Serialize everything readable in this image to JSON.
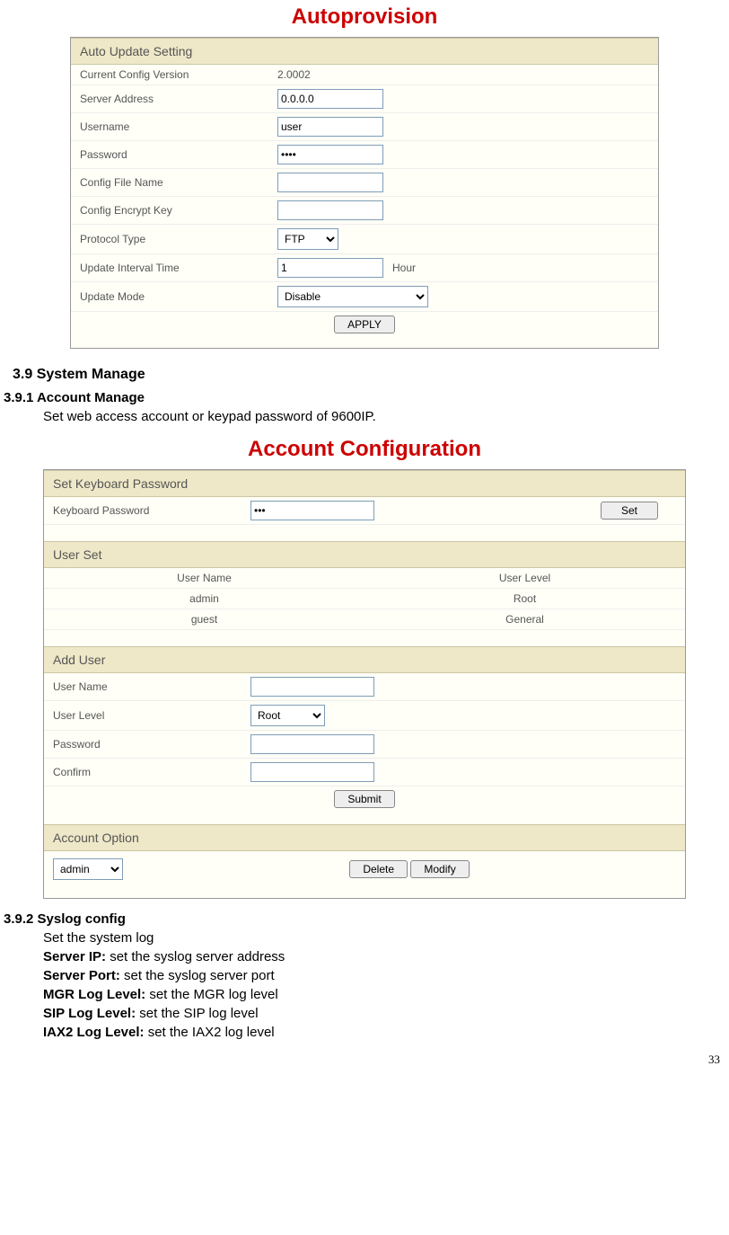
{
  "autoprovision": {
    "title": "Autoprovision",
    "section_header": "Auto Update Setting",
    "labels": {
      "current_config_version": "Current Config Version",
      "server_address": "Server Address",
      "username": "Username",
      "password": "Password",
      "config_file_name": "Config File Name",
      "config_encrypt_key": "Config Encrypt Key",
      "protocol_type": "Protocol Type",
      "update_interval_time": "Update Interval Time",
      "update_mode": "Update Mode",
      "hour": "Hour"
    },
    "values": {
      "current_config_version": "2.0002",
      "server_address": "0.0.0.0",
      "username": "user",
      "password": "••••",
      "config_file_name": "",
      "config_encrypt_key": "",
      "protocol_type": "FTP",
      "update_interval_time": "1",
      "update_mode": "Disable"
    },
    "apply_label": "APPLY"
  },
  "doc": {
    "h39": "3.9 System Manage",
    "h391": "3.9.1 Account Manage",
    "h391_para": "Set web access account or keypad password of 9600IP.",
    "h392": "3.9.2 Syslog config",
    "h392_para": "Set the system log",
    "syslog_lines": [
      {
        "bold": "Server IP:",
        "rest": " set the syslog server address"
      },
      {
        "bold": "Server Port:",
        "rest": " set the syslog server port"
      },
      {
        "bold": "MGR Log Level:",
        "rest": " set the MGR log level"
      },
      {
        "bold": "SIP Log Level:",
        "rest": " set the SIP log level"
      },
      {
        "bold": "IAX2 Log Level:",
        "rest": " set the IAX2 log level"
      }
    ],
    "page_number": "33"
  },
  "account": {
    "title": "Account Configuration",
    "sections": {
      "set_keyboard_password": "Set Keyboard Password",
      "user_set": "User Set",
      "add_user": "Add User",
      "account_option": "Account Option"
    },
    "keyboard_password": {
      "label": "Keyboard Password",
      "value": "•••",
      "set_label": "Set"
    },
    "user_table": {
      "headers": {
        "name": "User Name",
        "level": "User Level"
      },
      "rows": [
        {
          "name": "admin",
          "level": "Root"
        },
        {
          "name": "guest",
          "level": "General"
        }
      ]
    },
    "add_user": {
      "labels": {
        "user_name": "User Name",
        "user_level": "User Level",
        "password": "Password",
        "confirm": "Confirm"
      },
      "values": {
        "user_name": "",
        "user_level": "Root",
        "password": "",
        "confirm": ""
      },
      "submit_label": "Submit"
    },
    "account_option": {
      "select_value": "admin",
      "delete_label": "Delete",
      "modify_label": "Modify"
    }
  }
}
